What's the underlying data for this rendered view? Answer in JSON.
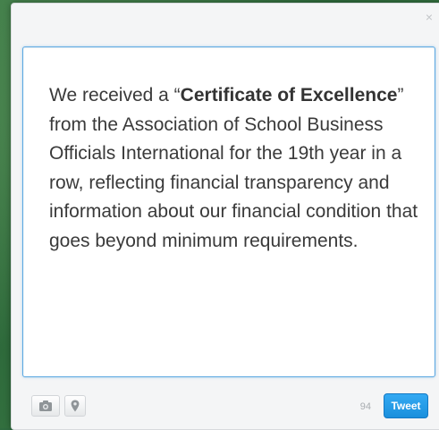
{
  "dialog": {
    "close_glyph": "×",
    "message": {
      "part1": "We received a “",
      "bold": "Certificate of Excellence",
      "part2": "” from the Association of School Business Officials International for the 19th year in a row, reflecting financial transparency and information about our financial condition that goes beyond minimum requirements."
    },
    "toolbar": {
      "photo_icon": "camera-icon",
      "geo_icon": "location-pin-icon",
      "char_count": "94",
      "tweet_label": "Tweet"
    }
  },
  "colors": {
    "background_green": "#2f6b3f",
    "focus_border": "#5aa8e2",
    "tweet_blue": "#1b8fdc"
  }
}
